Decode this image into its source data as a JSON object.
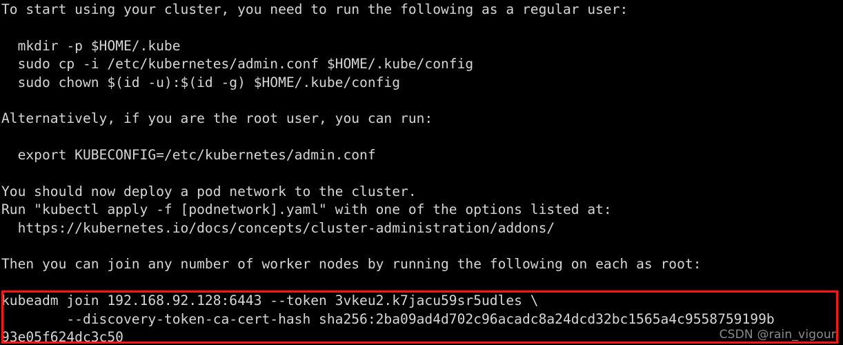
{
  "terminal": {
    "background_color": "#000000",
    "text_color": "#d6d6d6",
    "lines": [
      "To start using your cluster, you need to run the following as a regular user:",
      "",
      "  mkdir -p $HOME/.kube",
      "  sudo cp -i /etc/kubernetes/admin.conf $HOME/.kube/config",
      "  sudo chown $(id -u):$(id -g) $HOME/.kube/config",
      "",
      "Alternatively, if you are the root user, you can run:",
      "",
      "  export KUBECONFIG=/etc/kubernetes/admin.conf",
      "",
      "You should now deploy a pod network to the cluster.",
      "Run \"kubectl apply -f [podnetwork].yaml\" with one of the options listed at:",
      "  https://kubernetes.io/docs/concepts/cluster-administration/addons/",
      "",
      "Then you can join any number of worker nodes by running the following on each as root:",
      "",
      "kubeadm join 192.168.92.128:6443 --token 3vkeu2.k7jacu59sr5udles \\",
      "        --discovery-token-ca-cert-hash sha256:2ba09ad4d702c96acadc8a24dcd32bc1565a4c9558759199b",
      "93e05f624dc3c50"
    ]
  },
  "highlight": {
    "color": "#fb1413",
    "label": "join-command-highlight"
  },
  "watermark": {
    "text": "CSDN @rain_vigour",
    "color": "#8c8c8c"
  }
}
